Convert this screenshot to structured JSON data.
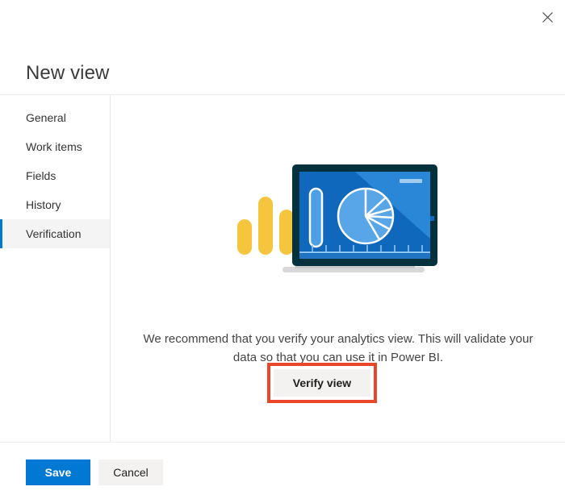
{
  "dialog": {
    "title": "New view",
    "close_label": "Close",
    "close_icon": "close-icon"
  },
  "sidebar": {
    "items": [
      {
        "label": "General",
        "selected": false
      },
      {
        "label": "Work items",
        "selected": false
      },
      {
        "label": "Fields",
        "selected": false
      },
      {
        "label": "History",
        "selected": false
      },
      {
        "label": "Verification",
        "selected": true
      }
    ]
  },
  "content": {
    "illustration": {
      "name": "analytics-tablet-illustration",
      "alt": "Tablet displaying a pie chart next to yellow bar chart columns",
      "colors": {
        "bezel": "#04313c",
        "screen": "#1068bd",
        "screen_highlight": "#2a87d8",
        "pie_fill": "#58a6e8",
        "pie_outline": "#ffffff",
        "bars": "#f6c53e",
        "pill": "#4d9fe6",
        "stand": "#d8d8d8",
        "axis": "#8fc5ef"
      }
    },
    "recommend_text": "We recommend that you verify your analytics view. This will validate your data so that you can use it in Power BI.",
    "verify_button_label": "Verify view",
    "annotation_color": "#e8472a"
  },
  "footer": {
    "save_label": "Save",
    "cancel_label": "Cancel",
    "save_color": "#0078d4"
  }
}
